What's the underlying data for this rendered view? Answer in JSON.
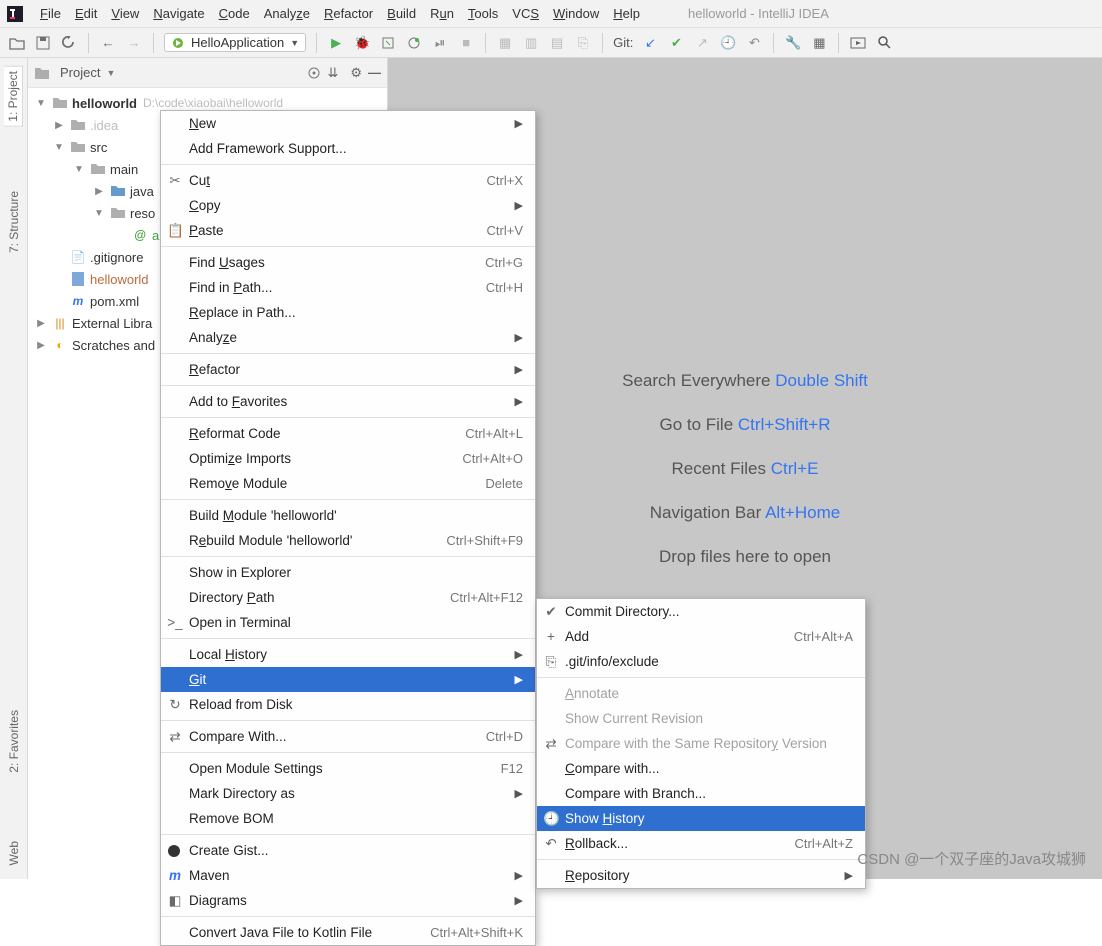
{
  "window": {
    "title": "helloworld - IntelliJ IDEA"
  },
  "menubar": [
    "File",
    "Edit",
    "View",
    "Navigate",
    "Code",
    "Analyze",
    "Refactor",
    "Build",
    "Run",
    "Tools",
    "VCS",
    "Window",
    "Help"
  ],
  "toolbar": {
    "run_config": "HelloApplication",
    "git_label": "Git:"
  },
  "left_tabs": [
    "1: Project",
    "7: Structure",
    "2: Favorites",
    "Web"
  ],
  "project_header": {
    "label": "Project"
  },
  "tree": {
    "root": {
      "name": "helloworld",
      "path": "D:\\code\\xiaobai\\helloworld"
    },
    "items": [
      {
        "name": ".idea",
        "indent": 1
      },
      {
        "name": "src",
        "indent": 1,
        "exp": true
      },
      {
        "name": "main",
        "indent": 2,
        "exp": true
      },
      {
        "name": "java",
        "indent": 3
      },
      {
        "name": "reso",
        "indent": 3,
        "exp": true
      },
      {
        "name": "a",
        "indent": 4,
        "file": true
      },
      {
        "name": ".gitignore",
        "indent": 1,
        "file": true
      },
      {
        "name": "helloworld",
        "indent": 1,
        "file": true,
        "color": "#bf6a3a"
      },
      {
        "name": "pom.xml",
        "indent": 1,
        "file": true,
        "icon": "m"
      },
      {
        "name": "External Libra",
        "indent": 0,
        "lib": true
      },
      {
        "name": "Scratches and",
        "indent": 0,
        "scratch": true
      }
    ]
  },
  "tips": [
    {
      "label": "Search Everywhere",
      "key": "Double Shift"
    },
    {
      "label": "Go to File",
      "key": "Ctrl+Shift+R"
    },
    {
      "label": "Recent Files",
      "key": "Ctrl+E"
    },
    {
      "label": "Navigation Bar",
      "key": "Alt+Home"
    },
    {
      "label": "Drop files here to open",
      "key": ""
    }
  ],
  "context_menu": [
    {
      "label": "New",
      "sub": true
    },
    {
      "label": "Add Framework Support..."
    },
    {
      "sep": true
    },
    {
      "label": "Cut",
      "shortcut": "Ctrl+X",
      "icon": "✂"
    },
    {
      "label": "Copy",
      "sub": true
    },
    {
      "label": "Paste",
      "shortcut": "Ctrl+V",
      "icon": "📋"
    },
    {
      "sep": true
    },
    {
      "label": "Find Usages",
      "shortcut": "Ctrl+G"
    },
    {
      "label": "Find in Path...",
      "shortcut": "Ctrl+H"
    },
    {
      "label": "Replace in Path..."
    },
    {
      "label": "Analyze",
      "sub": true
    },
    {
      "sep": true
    },
    {
      "label": "Refactor",
      "sub": true
    },
    {
      "sep": true
    },
    {
      "label": "Add to Favorites",
      "sub": true
    },
    {
      "sep": true
    },
    {
      "label": "Reformat Code",
      "shortcut": "Ctrl+Alt+L"
    },
    {
      "label": "Optimize Imports",
      "shortcut": "Ctrl+Alt+O"
    },
    {
      "label": "Remove Module",
      "shortcut": "Delete"
    },
    {
      "sep": true
    },
    {
      "label": "Build Module 'helloworld'"
    },
    {
      "label": "Rebuild Module 'helloworld'",
      "shortcut": "Ctrl+Shift+F9"
    },
    {
      "sep": true
    },
    {
      "label": "Show in Explorer"
    },
    {
      "label": "Directory Path",
      "shortcut": "Ctrl+Alt+F12"
    },
    {
      "label": "Open in Terminal",
      "icon": ">_"
    },
    {
      "sep": true
    },
    {
      "label": "Local History",
      "sub": true
    },
    {
      "label": "Git",
      "sub": true,
      "selected": true
    },
    {
      "label": "Reload from Disk",
      "icon": "↻"
    },
    {
      "sep": true
    },
    {
      "label": "Compare With...",
      "shortcut": "Ctrl+D",
      "icon": "⇄"
    },
    {
      "sep": true
    },
    {
      "label": "Open Module Settings",
      "shortcut": "F12"
    },
    {
      "label": "Mark Directory as",
      "sub": true
    },
    {
      "label": "Remove BOM"
    },
    {
      "sep": true
    },
    {
      "label": "Create Gist...",
      "icon": "gh"
    },
    {
      "label": "Maven",
      "sub": true,
      "icon": "m"
    },
    {
      "label": "Diagrams",
      "sub": true,
      "icon": "◧"
    },
    {
      "sep": true
    },
    {
      "label": "Convert Java File to Kotlin File",
      "shortcut": "Ctrl+Alt+Shift+K"
    }
  ],
  "git_submenu": [
    {
      "label": "Commit Directory...",
      "icon": "✔"
    },
    {
      "label": "Add",
      "shortcut": "Ctrl+Alt+A",
      "icon": "+"
    },
    {
      "label": ".git/info/exclude",
      "icon": "⎘"
    },
    {
      "sep": true
    },
    {
      "label": "Annotate",
      "disabled": true
    },
    {
      "label": "Show Current Revision",
      "disabled": true
    },
    {
      "label": "Compare with the Same Repository Version",
      "disabled": true,
      "icon": "⇄"
    },
    {
      "label": "Compare with..."
    },
    {
      "label": "Compare with Branch..."
    },
    {
      "label": "Show History",
      "selected": true,
      "icon": "🕘"
    },
    {
      "label": "Rollback...",
      "shortcut": "Ctrl+Alt+Z",
      "icon": "↶"
    },
    {
      "sep": true
    },
    {
      "label": "Repository",
      "sub": true
    }
  ],
  "watermark": "CSDN @一个双子座的Java攻城狮"
}
